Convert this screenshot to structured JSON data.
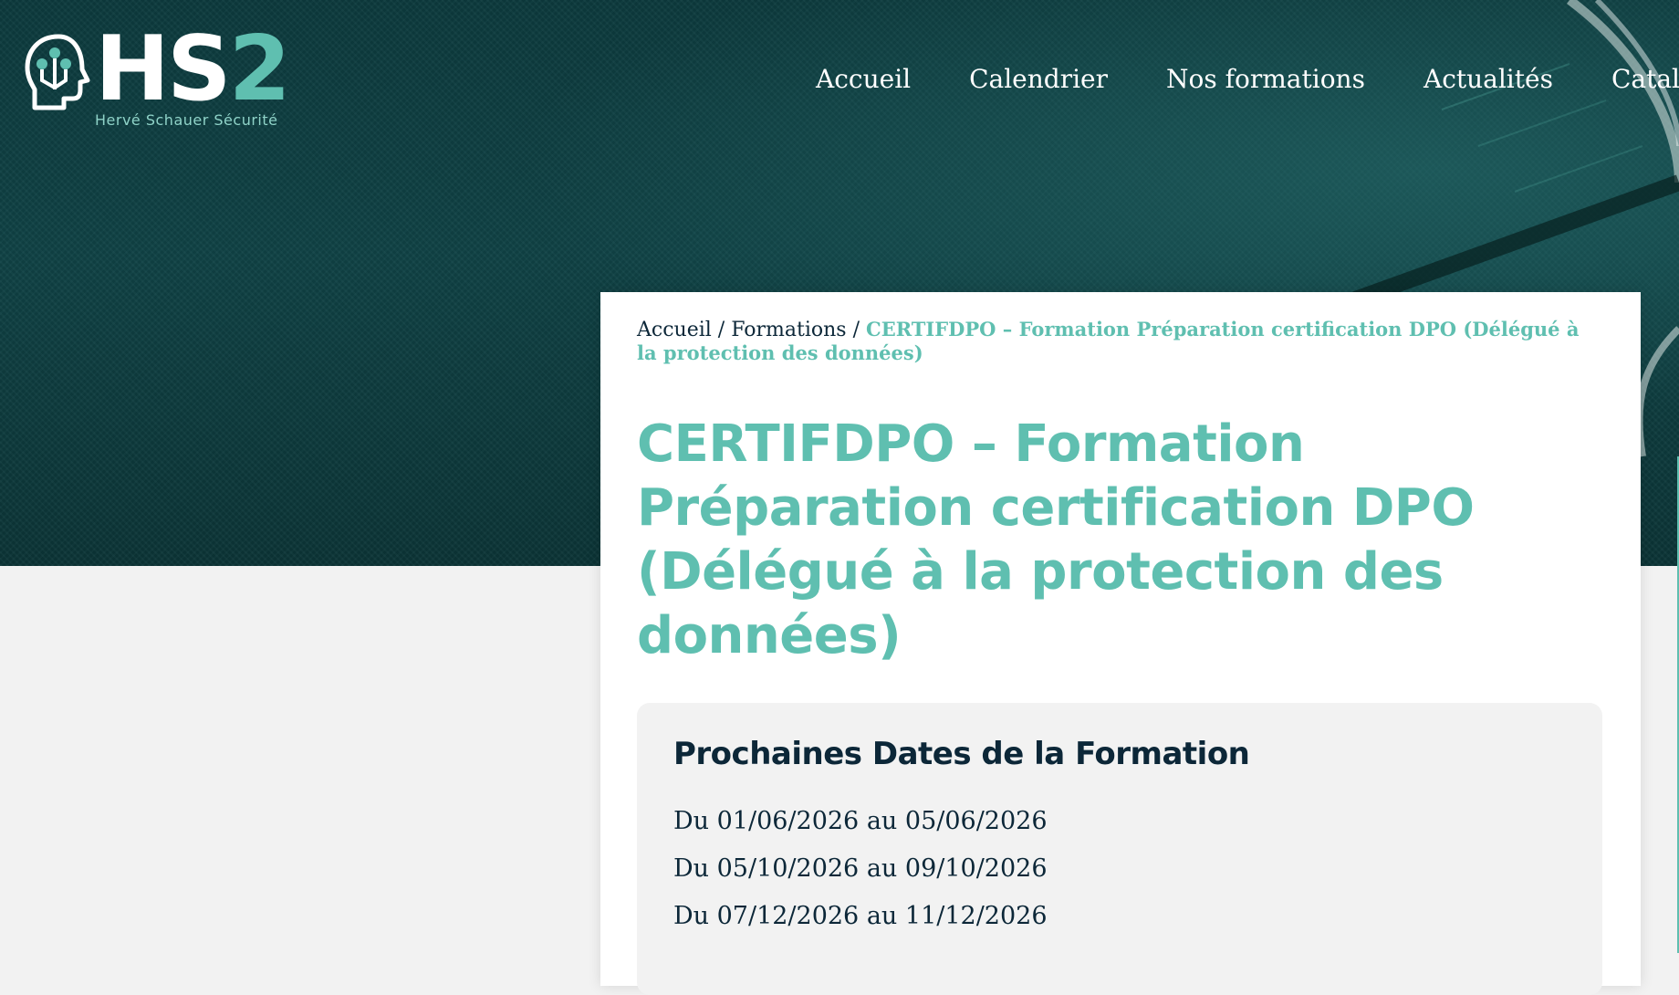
{
  "brand": {
    "logo_text_main": "HS",
    "logo_text_accent": "2",
    "tagline": "Hervé Schauer Sécurité",
    "colors": {
      "accent": "#5fbfb0",
      "dark": "#0c2738",
      "hero": "#0f4245"
    }
  },
  "nav": {
    "items": [
      {
        "label": "Accueil"
      },
      {
        "label": "Calendrier"
      },
      {
        "label": "Nos formations"
      },
      {
        "label": "Actualités"
      },
      {
        "label": "Catalog"
      }
    ]
  },
  "breadcrumb": {
    "home": "Accueil",
    "sep1": " / ",
    "section": "Formations",
    "sep2": " / ",
    "current": "CERTIFDPO – Formation Préparation certification DPO (Délégué à la protection des données)"
  },
  "page": {
    "title": "CERTIFDPO – Formation Préparation certification DPO (Délégué à la protection des données)"
  },
  "dates": {
    "heading": "Prochaines Dates de la Formation",
    "items": [
      "Du 01/06/2026 au 05/06/2026",
      "Du 05/10/2026 au 09/10/2026",
      "Du 07/12/2026 au 11/12/2026"
    ]
  }
}
